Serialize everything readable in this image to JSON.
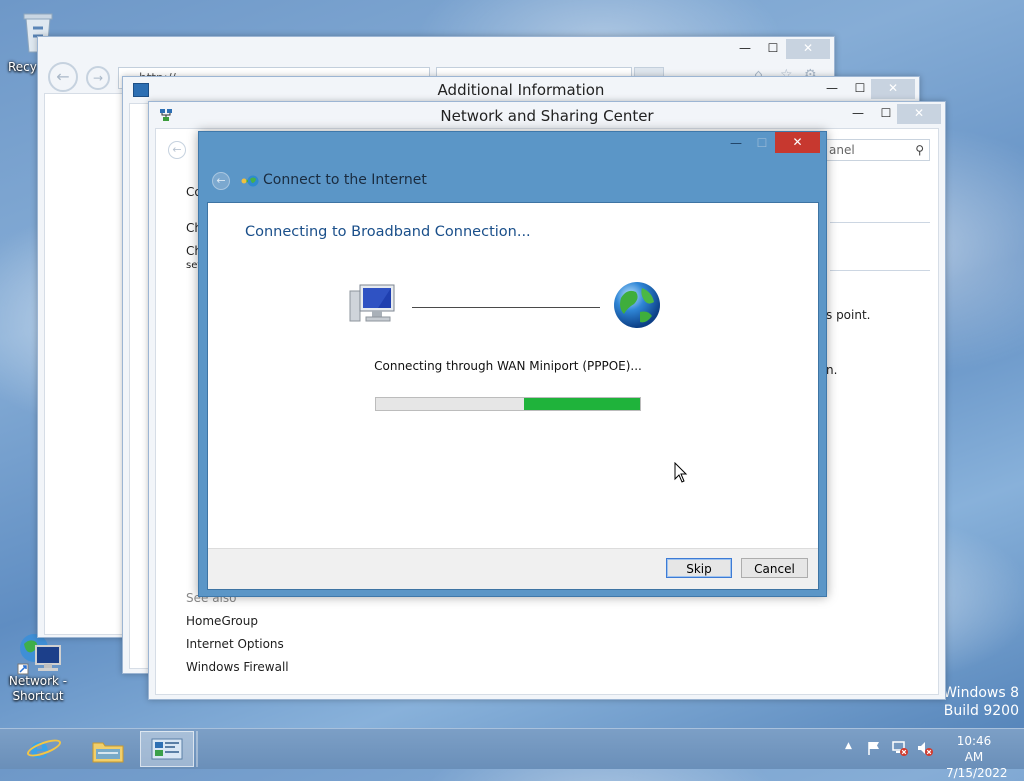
{
  "desktop": {
    "icons": [
      {
        "label": "Recy"
      },
      {
        "label": "Network - Shortcut"
      }
    ],
    "watermark_line1": "Windows 8",
    "watermark_line2": "Build 9200"
  },
  "ie_window": {
    "address_text": "http://...",
    "tab_text": "..."
  },
  "additional_info_window": {
    "title": "Additional Information"
  },
  "nsc_window": {
    "title": "Network and Sharing Center",
    "search_placeholder": "anel",
    "left_text_1": "Co",
    "left_text_2": "Ch",
    "left_text_3": "Ch",
    "left_text_3b": "set",
    "right_text_1": "s point.",
    "right_text_2": "n.",
    "see_also_label": "See also",
    "see_also_links": [
      "HomeGroup",
      "Internet Options",
      "Windows Firewall"
    ]
  },
  "dialog": {
    "title": "Connect to the Internet",
    "heading": "Connecting to Broadband Connection...",
    "status_text": "Connecting through WAN Miniport (PPPOE)...",
    "progress_fraction": 0.44,
    "skip_label": "Skip",
    "cancel_label": "Cancel",
    "minimize_glyph": "—",
    "maximize_glyph": "☐",
    "close_glyph": "✕"
  },
  "taskbar": {
    "time": "10:46 AM",
    "date": "7/15/2022",
    "apps": [
      "internet-explorer",
      "file-explorer",
      "control-panel"
    ]
  },
  "colors": {
    "dialog_frame": "#5b96c7",
    "heading_blue": "#1a4f8a",
    "progress_green": "#1fb33b",
    "link_color": "#1e1e1e"
  }
}
